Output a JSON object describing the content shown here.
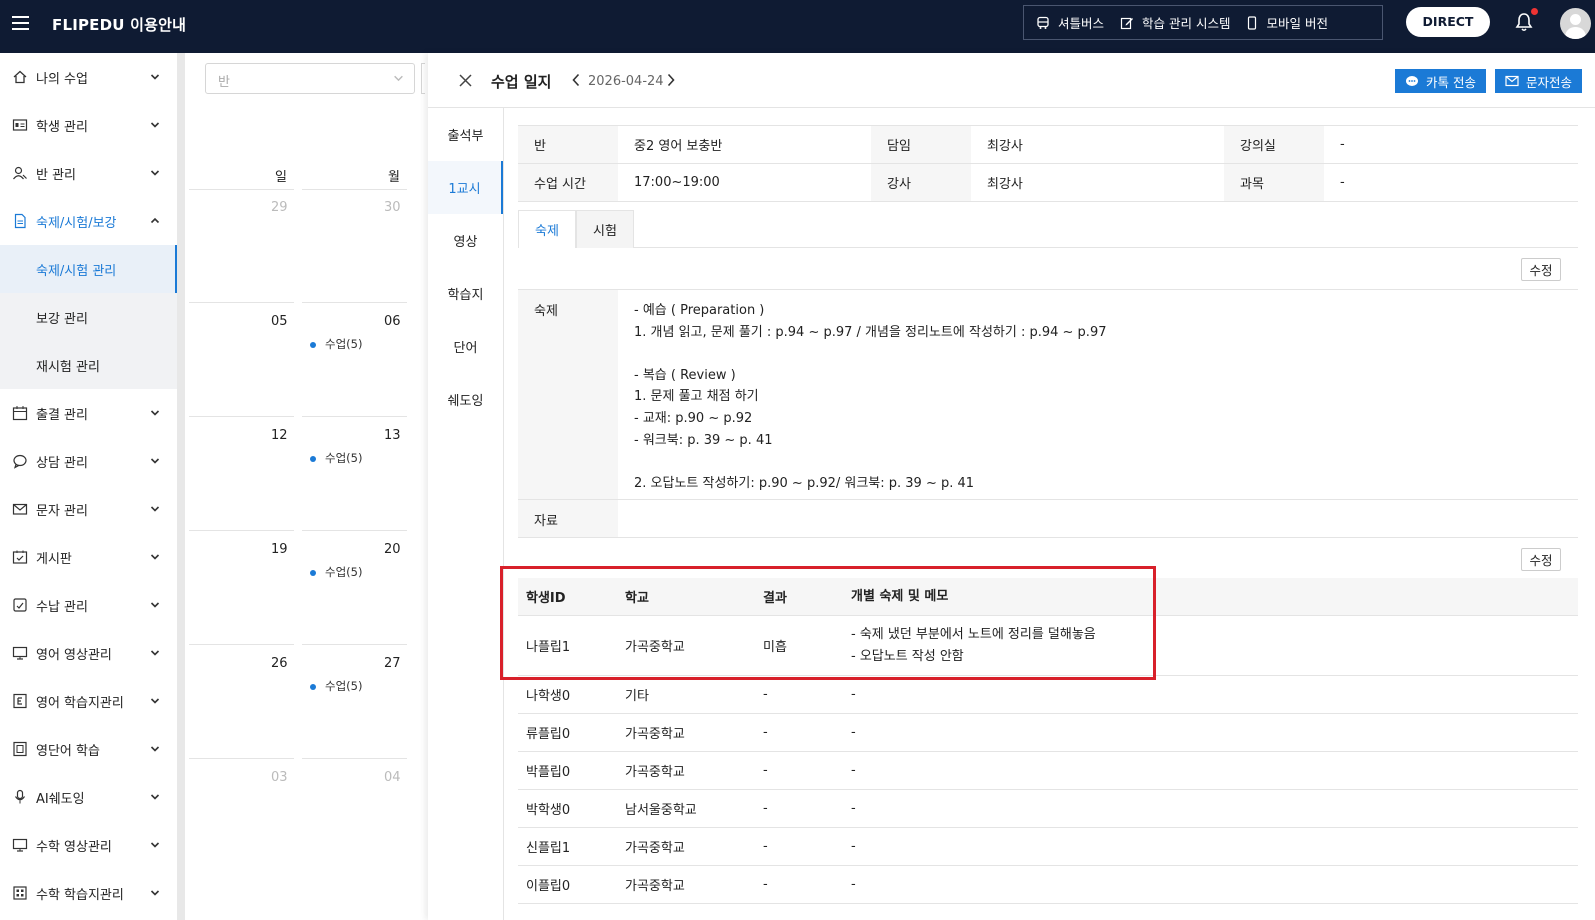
{
  "header": {
    "brand": "FLIPEDU 이용안내",
    "nav": [
      {
        "label": "셔틀버스",
        "icon": "bus-icon"
      },
      {
        "label": "학습 관리 시스템",
        "icon": "edit-icon"
      },
      {
        "label": "모바일 버전",
        "icon": "mobile-icon"
      }
    ],
    "direct_label": "DIRECT"
  },
  "sidebar": {
    "items": [
      {
        "label": "나의 수업",
        "icon": "home-icon"
      },
      {
        "label": "학생 관리",
        "icon": "id-card-icon"
      },
      {
        "label": "반 관리",
        "icon": "users-icon"
      },
      {
        "label": "숙제/시험/보강",
        "icon": "document-icon",
        "active": true,
        "sub": [
          {
            "label": "숙제/시험 관리",
            "active": true
          },
          {
            "label": "보강 관리"
          },
          {
            "label": "재시험 관리"
          }
        ]
      },
      {
        "label": "출결 관리",
        "icon": "calendar-icon"
      },
      {
        "label": "상담 관리",
        "icon": "chat-icon"
      },
      {
        "label": "문자 관리",
        "icon": "mail-icon"
      },
      {
        "label": "게시판",
        "icon": "board-icon"
      },
      {
        "label": "수납 관리",
        "icon": "payment-icon"
      },
      {
        "label": "영어 영상관리",
        "icon": "monitor-icon"
      },
      {
        "label": "영어 학습지관리",
        "icon": "sheet-icon"
      },
      {
        "label": "영단어 학습",
        "icon": "book-icon"
      },
      {
        "label": "AI쉐도잉",
        "icon": "mic-icon"
      },
      {
        "label": "수학 영상관리",
        "icon": "monitor-icon"
      },
      {
        "label": "수학 학습지관리",
        "icon": "grid-icon"
      }
    ]
  },
  "calendar": {
    "select_placeholder": "반",
    "days": [
      "일",
      "월"
    ],
    "weeks": [
      {
        "sun": "29",
        "mon": "30",
        "dim": true,
        "event": ""
      },
      {
        "sun": "05",
        "mon": "06",
        "event": "수업(5)"
      },
      {
        "sun": "12",
        "mon": "13",
        "event": "수업(5)"
      },
      {
        "sun": "19",
        "mon": "20",
        "event": "수업(5)"
      },
      {
        "sun": "26",
        "mon": "27",
        "event": "수업(5)"
      },
      {
        "sun": "03",
        "mon": "04",
        "dim": true,
        "event": ""
      }
    ]
  },
  "modal": {
    "title": "수업 일지",
    "date": "2026-04-24",
    "kakao_label": "카톡 전송",
    "sms_label": "문자전송",
    "left_tabs": [
      "출석부",
      "1교시",
      "영상",
      "학습지",
      "단어",
      "쉐도잉"
    ],
    "info": {
      "class_label": "반",
      "class_value": "중2 영어 보충반",
      "homeroom_label": "담임",
      "homeroom_value": "최강사",
      "room_label": "강의실",
      "room_value": "-",
      "time_label": "수업 시간",
      "time_value": "17:00~19:00",
      "teacher_label": "강사",
      "teacher_value": "최강사",
      "subject_label": "과목",
      "subject_value": "-"
    },
    "sub_tabs": [
      "숙제",
      "시험"
    ],
    "edit_label": "수정",
    "homework_label": "숙제",
    "homework_text": "- 예습 ( Preparation )\n1. 개념 읽고, 문제 풀기 : p.94 ~ p.97 / 개념을 정리노트에 작성하기 : p.94 ~ p.97\n\n- 복습 ( Review )\n1. 문제 풀고 채점 하기\n- 교재: p.90 ~ p.92\n- 워크북: p. 39 ~ p. 41\n\n2. 오답노트 작성하기: p.90 ~ p.92/ 워크북: p. 39 ~ p. 41",
    "material_label": "자료",
    "material_value": "",
    "student_columns": [
      "학생ID",
      "학교",
      "결과",
      "개별 숙제 및 메모"
    ],
    "students": [
      {
        "id": "나플립1",
        "school": "가곡중학교",
        "result": "미흡",
        "memo": "- 숙제 냈던 부분에서 노트에 정리를 덜해놓음\n- 오답노트 작성 안함"
      },
      {
        "id": "나학생0",
        "school": "기타",
        "result": "-",
        "memo": "-"
      },
      {
        "id": "류플립0",
        "school": "가곡중학교",
        "result": "-",
        "memo": "-"
      },
      {
        "id": "박플립0",
        "school": "가곡중학교",
        "result": "-",
        "memo": "-"
      },
      {
        "id": "박학생0",
        "school": "남서울중학교",
        "result": "-",
        "memo": "-"
      },
      {
        "id": "신플립1",
        "school": "가곡중학교",
        "result": "-",
        "memo": "-"
      },
      {
        "id": "이플립0",
        "school": "가곡중학교",
        "result": "-",
        "memo": "-"
      }
    ]
  },
  "colors": {
    "accent": "#1b7ad6",
    "topbar": "#0f1b33",
    "highlight": "#d8202a"
  }
}
